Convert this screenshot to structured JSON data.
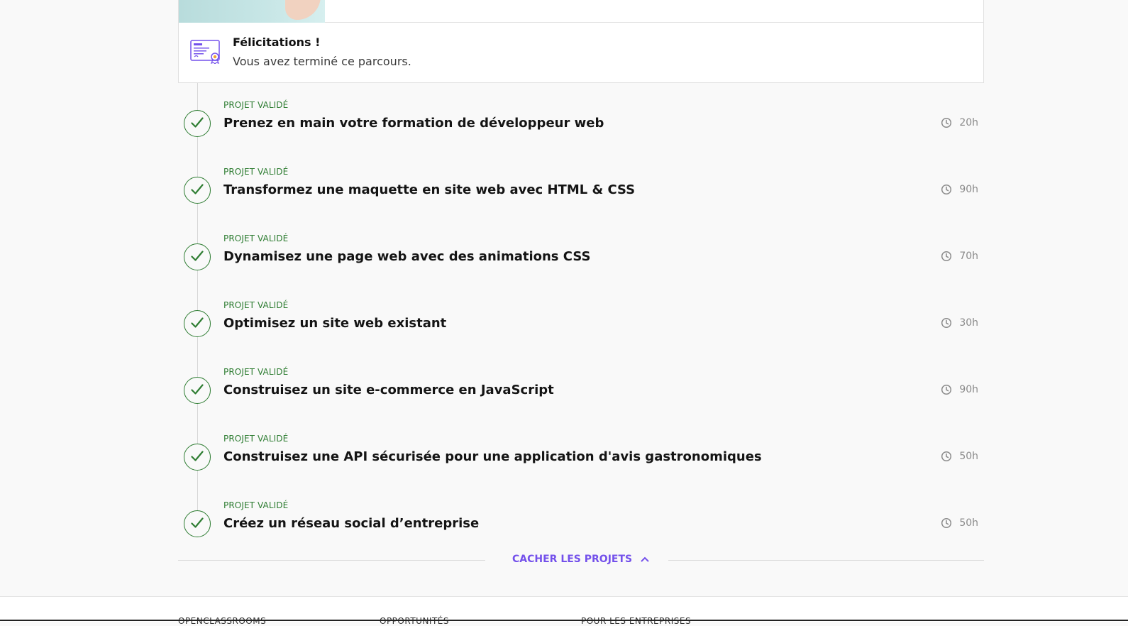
{
  "congrats": {
    "title": "Félicitations !",
    "text": "Vous avez terminé ce parcours."
  },
  "projects": [
    {
      "status": "PROJET VALIDÉ",
      "title": "Prenez en main votre formation de développeur web",
      "duration": "20h"
    },
    {
      "status": "PROJET VALIDÉ",
      "title": "Transformez une maquette en site web avec HTML & CSS",
      "duration": "90h"
    },
    {
      "status": "PROJET VALIDÉ",
      "title": "Dynamisez une page web avec des animations CSS",
      "duration": "70h"
    },
    {
      "status": "PROJET VALIDÉ",
      "title": "Optimisez un site web existant",
      "duration": "30h"
    },
    {
      "status": "PROJET VALIDÉ",
      "title": "Construisez un site e-commerce en JavaScript",
      "duration": "90h"
    },
    {
      "status": "PROJET VALIDÉ",
      "title": "Construisez une API sécurisée pour une application d'avis gastronomiques",
      "duration": "50h"
    },
    {
      "status": "PROJET VALIDÉ",
      "title": "Créez un réseau social d’entreprise",
      "duration": "50h"
    }
  ],
  "toggle": {
    "label": "CACHER LES PROJETS"
  },
  "footer": {
    "columns": [
      "OPENCLASSROOMS",
      "OPPORTUNITÉS",
      "POUR LES ENTREPRISES"
    ]
  },
  "colors": {
    "accent": "#7451eb",
    "success": "#2e7d32"
  },
  "icons": {
    "status": "check-icon",
    "duration": "clock-icon",
    "toggle": "chevron-up-icon",
    "certificate": "certificate-icon"
  }
}
